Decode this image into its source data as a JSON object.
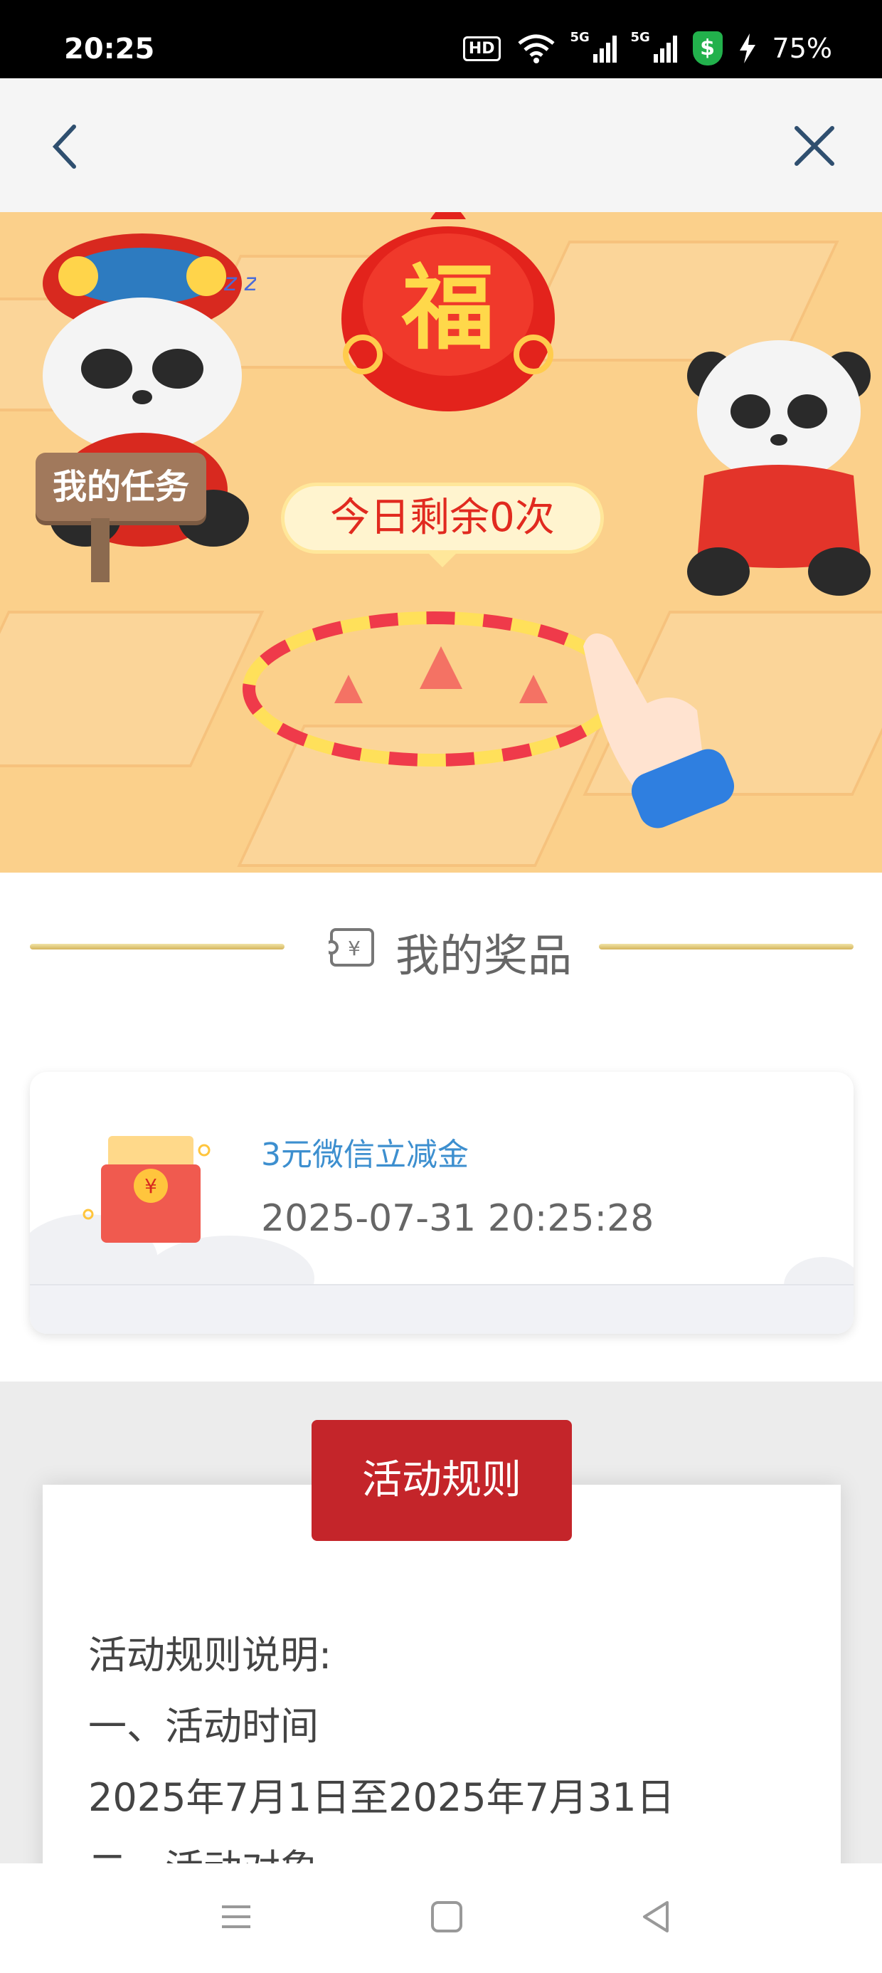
{
  "status_bar": {
    "time": "20:25",
    "hd_label": "HD",
    "network_1": "5G",
    "network_2": "5G",
    "battery": "75%",
    "icons": [
      "hd-voice-icon",
      "wifi-icon",
      "signal-icon",
      "signal-icon",
      "shield-icon",
      "charging-icon"
    ]
  },
  "nav": {
    "back_icon": "chevron-left-icon",
    "close_icon": "close-icon"
  },
  "banner": {
    "fortune_char": "福",
    "my_tasks_label": "我的任务",
    "remaining_text": "今日剩余0次"
  },
  "prizes": {
    "title": "我的奖品",
    "items": [
      {
        "name": "3元微信立减金",
        "date": "2025-07-31 20:25:28",
        "currency_symbol": "¥"
      }
    ]
  },
  "rules": {
    "button_label": "活动规则",
    "lines": [
      "活动规则说明:",
      "一、活动时间",
      "2025年7月1日至2025年7月31日",
      "二、活动对象"
    ]
  },
  "system_nav": {
    "icons": [
      "menu-icon",
      "home-icon",
      "back-triangle-icon"
    ]
  },
  "colors": {
    "accent_red": "#c4252a",
    "banner_bg": "#fbd08b",
    "link_blue": "#3d8fcf"
  }
}
